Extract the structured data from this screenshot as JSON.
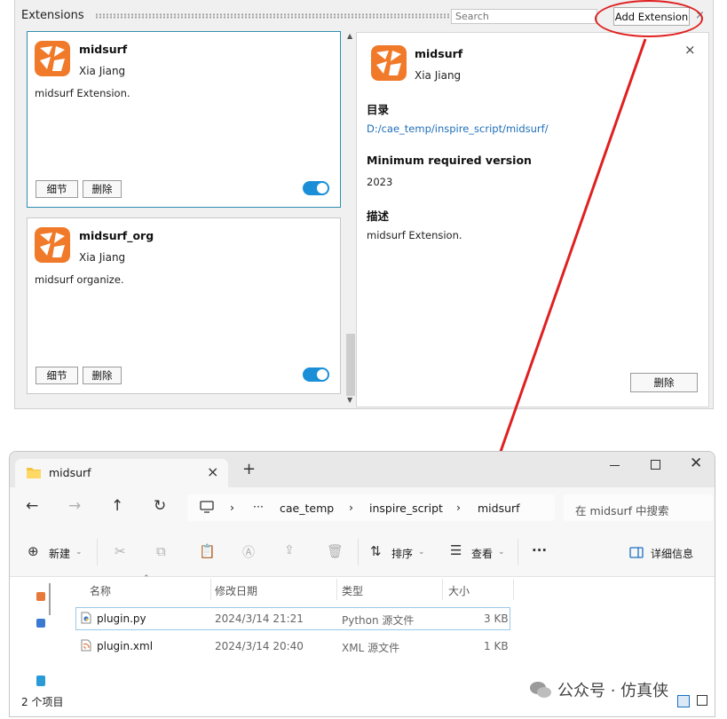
{
  "extensions": {
    "title": "Extensions",
    "search_placeholder": "Search",
    "add_button": "Add Extension",
    "close_glyph": "×",
    "cards": [
      {
        "name": "midsurf",
        "author": "Xia Jiang",
        "description": "midsurf Extension.",
        "details_button": "细节",
        "delete_button": "删除",
        "enabled": true
      },
      {
        "name": "midsurf_org",
        "author": "Xia Jiang",
        "description": "midsurf organize.",
        "details_button": "细节",
        "delete_button": "删除",
        "enabled": true
      }
    ],
    "detail": {
      "name": "midsurf",
      "author": "Xia Jiang",
      "dir_label": "目录",
      "dir_value": "D:/cae_temp/inspire_script/midsurf/",
      "minver_label": "Minimum required version",
      "minver_value": "2023",
      "desc_label": "描述",
      "desc_value": "midsurf Extension.",
      "delete_button": "删除",
      "close_glyph": "×"
    }
  },
  "explorer": {
    "tab_title": "midsurf",
    "tab_close": "×",
    "new_tab": "+",
    "address": {
      "more": "···",
      "crumbs": [
        "cae_temp",
        "inspire_script",
        "midsurf"
      ]
    },
    "search_placeholder": "在 midsurf 中搜索",
    "toolbar": {
      "new": "新建",
      "sort": "排序",
      "view": "查看",
      "more": "···",
      "details": "详细信息"
    },
    "columns": [
      "名称",
      "修改日期",
      "类型",
      "大小"
    ],
    "files": [
      {
        "name": "plugin.py",
        "date": "2024/3/14 21:21",
        "type": "Python 源文件",
        "size": "3 KB"
      },
      {
        "name": "plugin.xml",
        "date": "2024/3/14 20:40",
        "type": "XML 源文件",
        "size": "1 KB"
      }
    ],
    "status": "2 个项目"
  },
  "watermark": "公众号 · 仿真侠",
  "colors": {
    "accent": "#1a8fd8",
    "annotation": "#e02020",
    "link": "#1f6fb8",
    "logo": "#f07a2a"
  }
}
